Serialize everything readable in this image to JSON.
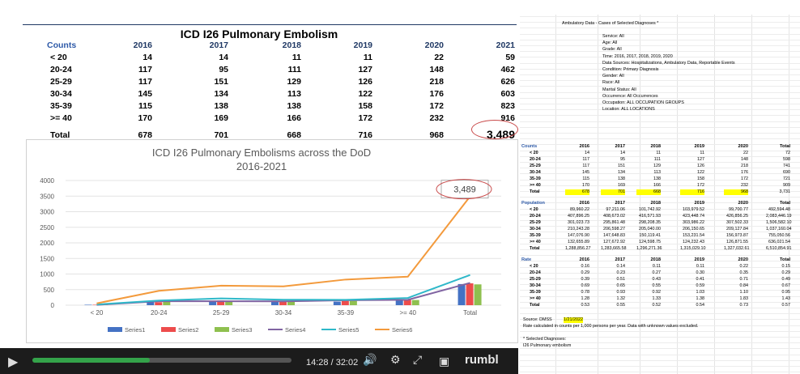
{
  "left_table": {
    "title": "ICD I26 Pulmonary Embolism",
    "header": [
      "Counts",
      "2016",
      "2017",
      "2018",
      "2019",
      "2020",
      "2021"
    ],
    "rows": [
      {
        "label": "< 20",
        "values": [
          "14",
          "14",
          "11",
          "11",
          "22",
          "59"
        ]
      },
      {
        "label": "20-24",
        "values": [
          "117",
          "95",
          "111",
          "127",
          "148",
          "462"
        ]
      },
      {
        "label": "25-29",
        "values": [
          "117",
          "151",
          "129",
          "126",
          "218",
          "626"
        ]
      },
      {
        "label": "30-34",
        "values": [
          "145",
          "134",
          "113",
          "122",
          "176",
          "603"
        ]
      },
      {
        "label": "35-39",
        "values": [
          "115",
          "138",
          "138",
          "158",
          "172",
          "823"
        ]
      },
      {
        "label": ">= 40",
        "values": [
          "170",
          "169",
          "166",
          "172",
          "232",
          "916"
        ]
      },
      {
        "label": "Total",
        "values": [
          "678",
          "701",
          "668",
          "716",
          "968",
          "3,489"
        ]
      }
    ]
  },
  "chart_data": {
    "type": "line",
    "title": "ICD I26 Pulmonary Embolisms across the DoD",
    "subtitle": "2016-2021",
    "categories": [
      "< 20",
      "20-24",
      "25-29",
      "30-34",
      "35-39",
      ">= 40",
      "Total"
    ],
    "yticks": [
      "0",
      "500",
      "1000",
      "1500",
      "2000",
      "2500",
      "3000",
      "3500",
      "4000"
    ],
    "ylim": [
      0,
      4000
    ],
    "callout": "3,489",
    "legend_position": "bottom",
    "series": [
      {
        "name": "Series1",
        "kind": "bar",
        "color": "#4472c4",
        "values": [
          14,
          117,
          117,
          145,
          115,
          170,
          678
        ]
      },
      {
        "name": "Series2",
        "kind": "bar",
        "color": "#ed4c4c",
        "values": [
          14,
          95,
          151,
          134,
          138,
          169,
          701
        ]
      },
      {
        "name": "Series3",
        "kind": "bar",
        "color": "#8fc04f",
        "values": [
          11,
          111,
          129,
          113,
          138,
          166,
          668
        ]
      },
      {
        "name": "Series4",
        "kind": "line",
        "color": "#8064a2",
        "values": [
          11,
          127,
          126,
          122,
          158,
          172,
          716
        ]
      },
      {
        "name": "Series5",
        "kind": "line",
        "color": "#2fb8c9",
        "values": [
          22,
          148,
          218,
          176,
          172,
          232,
          968
        ]
      },
      {
        "name": "Series6",
        "kind": "line",
        "color": "#f39a3c",
        "values": [
          59,
          462,
          626,
          603,
          823,
          916,
          3489
        ]
      }
    ]
  },
  "report": {
    "header": "Ambulatory Data - Cases of Selected Diagnoses *",
    "filters": [
      "Service: All",
      "Age: All",
      "Grade: All",
      "Time: 2016, 2017, 2018, 2019, 2020",
      "Data Sources: Hospitalizations, Ambulatory Data, Reportable Events",
      "Condition: Primary Diagnosis",
      "Gender: All",
      "Race: All",
      "Marital Status: All",
      "Occurrence: All Occurrences",
      "Occupation: ALL OCCUPATION GROUPS",
      "Location: ALL LOCATIONS"
    ],
    "columns": [
      "2016",
      "2017",
      "2018",
      "2019",
      "2020",
      "Total"
    ],
    "sections": [
      {
        "title": "Counts",
        "rows": [
          {
            "label": "< 20",
            "values": [
              "14",
              "14",
              "11",
              "11",
              "22",
              "72"
            ]
          },
          {
            "label": "20-24",
            "values": [
              "117",
              "95",
              "111",
              "127",
              "148",
              "598"
            ]
          },
          {
            "label": "25-29",
            "values": [
              "117",
              "151",
              "129",
              "126",
              "218",
              "741"
            ]
          },
          {
            "label": "30-34",
            "values": [
              "145",
              "134",
              "113",
              "122",
              "176",
              "690"
            ]
          },
          {
            "label": "35-39",
            "values": [
              "115",
              "138",
              "138",
              "158",
              "172",
              "721"
            ]
          },
          {
            "label": ">= 40",
            "values": [
              "170",
              "169",
              "166",
              "172",
              "232",
              "909"
            ]
          },
          {
            "label": "Total",
            "values": [
              "678",
              "701",
              "668",
              "716",
              "968",
              "3,731"
            ]
          }
        ]
      },
      {
        "title": "Population",
        "rows": [
          {
            "label": "< 20",
            "values": [
              "89,960.22",
              "97,211.06",
              "101,742.92",
              "103,979.52",
              "99,700.77",
              "492,594.48"
            ]
          },
          {
            "label": "20-24",
            "values": [
              "407,896.25",
              "408,673.02",
              "416,571.93",
              "423,448.74",
              "426,856.25",
              "2,083,446.19"
            ]
          },
          {
            "label": "25-29",
            "values": [
              "301,023.73",
              "295,861.48",
              "298,208.35",
              "303,986.22",
              "307,502.33",
              "1,506,582.10"
            ]
          },
          {
            "label": "30-34",
            "values": [
              "210,243.28",
              "206,598.27",
              "205,040.00",
              "206,150.65",
              "209,127.84",
              "1,037,160.04"
            ]
          },
          {
            "label": "35-39",
            "values": [
              "147,076.90",
              "147,648.83",
              "150,119.41",
              "153,231.54",
              "156,973.87",
              "755,050.56"
            ]
          },
          {
            "label": ">= 40",
            "values": [
              "132,655.89",
              "127,672.92",
              "124,598.75",
              "124,232.43",
              "126,871.55",
              "636,021.54"
            ]
          },
          {
            "label": "Total",
            "values": [
              "1,288,856.27",
              "1,283,665.58",
              "1,296,271.36",
              "1,315,029.10",
              "1,327,032.61",
              "6,510,854.91"
            ]
          }
        ]
      },
      {
        "title": "Rate",
        "rows": [
          {
            "label": "< 20",
            "values": [
              "0.16",
              "0.14",
              "0.11",
              "0.11",
              "0.22",
              "0.15"
            ]
          },
          {
            "label": "20-24",
            "values": [
              "0.29",
              "0.23",
              "0.27",
              "0.30",
              "0.35",
              "0.29"
            ]
          },
          {
            "label": "25-29",
            "values": [
              "0.39",
              "0.51",
              "0.43",
              "0.41",
              "0.71",
              "0.49"
            ]
          },
          {
            "label": "30-34",
            "values": [
              "0.69",
              "0.65",
              "0.55",
              "0.59",
              "0.84",
              "0.67"
            ]
          },
          {
            "label": "35-39",
            "values": [
              "0.78",
              "0.93",
              "0.92",
              "1.03",
              "1.10",
              "0.95"
            ]
          },
          {
            "label": ">= 40",
            "values": [
              "1.28",
              "1.32",
              "1.33",
              "1.38",
              "1.83",
              "1.43"
            ]
          },
          {
            "label": "Total",
            "values": [
              "0.53",
              "0.55",
              "0.52",
              "0.54",
              "0.73",
              "0.57"
            ]
          }
        ]
      }
    ],
    "source_label": "Source: DMSS",
    "source_date": "1/21/2022",
    "rate_note": "Rate calculated in counts per 1,000 persons per year. Data with unknown values excluded.",
    "selected_header": "* Selected Diagnoses:",
    "selected_value": "I26 Pulmonary embolism"
  },
  "player": {
    "time": "14:28 / 32:02",
    "brand": "rumbl",
    "progress": 0.452,
    "play_icon": "play-icon",
    "volume_icon": "volume-icon",
    "settings_icon": "gear-icon",
    "fullscreen_icon": "fullscreen-icon"
  }
}
